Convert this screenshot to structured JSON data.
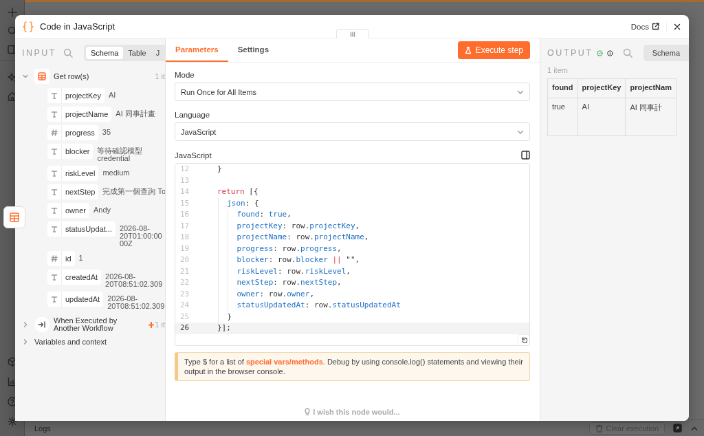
{
  "header": {
    "title": "Code in JavaScript",
    "docs": "Docs"
  },
  "input": {
    "label": "INPUT",
    "tabs": [
      {
        "label": "Schema",
        "selected": true
      },
      {
        "label": "Table",
        "selected": false
      },
      {
        "label": "J",
        "selected": false
      }
    ],
    "nodes": [
      {
        "name": "Get row(s)",
        "count": "1 it",
        "kind": "table",
        "expanded": true,
        "pinned": false,
        "fields": [
          {
            "kind": "string",
            "name": "projectKey",
            "value": "AI"
          },
          {
            "kind": "string",
            "name": "projectName",
            "value": "AI 同事計畫"
          },
          {
            "kind": "number",
            "name": "progress",
            "value": "35"
          },
          {
            "kind": "string",
            "name": "blocker",
            "value": "等待確認模型\ncredential"
          },
          {
            "kind": "string",
            "name": "riskLevel",
            "value": "medium"
          },
          {
            "kind": "string",
            "name": "nextStep",
            "value": "完成第一個查詢 To"
          },
          {
            "kind": "string",
            "name": "owner",
            "value": "Andy"
          },
          {
            "kind": "string",
            "name": "statusUpdat...",
            "value": "2026-08-\n20T01:00:00\n00Z"
          },
          {
            "kind": "number",
            "name": "id",
            "value": "1"
          },
          {
            "kind": "string",
            "name": "createdAt",
            "value": "2026-08-\n20T08:51:02.309"
          },
          {
            "kind": "string",
            "name": "updatedAt",
            "value": "2026-08-\n20T08:51:02.309"
          }
        ]
      },
      {
        "name": "When Executed by Another Workflow",
        "count": "1 it",
        "kind": "trigger",
        "expanded": false,
        "pinned": true
      }
    ],
    "variables": {
      "label": "Variables and context",
      "expanded": false
    }
  },
  "parameters": {
    "tabs": [
      {
        "label": "Parameters",
        "selected": true
      },
      {
        "label": "Settings",
        "selected": false
      }
    ],
    "execute_button": "Execute step",
    "fields": [
      {
        "label": "Mode",
        "value": "Run Once for All Items"
      },
      {
        "label": "Language",
        "value": "JavaScript"
      }
    ],
    "editor": {
      "label": "JavaScript",
      "lines": [
        {
          "number": "12",
          "active": false,
          "tokens": [
            {
              "kind": "plain",
              "text": "}"
            }
          ]
        },
        {
          "number": "13",
          "active": false
        },
        {
          "number": "14",
          "active": false,
          "tokens": [
            {
              "kind": "keyword",
              "text": "return"
            },
            {
              "kind": "plain",
              "text": " [{"
            }
          ],
          "children": [
            {
              "number": "15",
              "active": false,
              "tokens": [
                {
                  "kind": "property",
                  "text": "json"
                },
                {
                  "kind": "plain",
                  "text": ": {"
                }
              ],
              "children": [
                {
                  "number": "16",
                  "active": false,
                  "tokens": [
                    {
                      "kind": "property",
                      "text": "found"
                    },
                    {
                      "kind": "plain",
                      "text": ": "
                    },
                    {
                      "kind": "property",
                      "text": "true"
                    },
                    {
                      "kind": "plain",
                      "text": ","
                    }
                  ]
                },
                {
                  "number": "17",
                  "active": false,
                  "tokens": [
                    {
                      "kind": "property",
                      "text": "projectKey"
                    },
                    {
                      "kind": "plain",
                      "text": ": row."
                    },
                    {
                      "kind": "property",
                      "text": "projectKey"
                    },
                    {
                      "kind": "plain",
                      "text": ","
                    }
                  ]
                },
                {
                  "number": "18",
                  "active": false,
                  "tokens": [
                    {
                      "kind": "property",
                      "text": "projectName"
                    },
                    {
                      "kind": "plain",
                      "text": ": row."
                    },
                    {
                      "kind": "property",
                      "text": "projectName"
                    },
                    {
                      "kind": "plain",
                      "text": ","
                    }
                  ]
                },
                {
                  "number": "19",
                  "active": false,
                  "tokens": [
                    {
                      "kind": "property",
                      "text": "progress"
                    },
                    {
                      "kind": "plain",
                      "text": ": row."
                    },
                    {
                      "kind": "property",
                      "text": "progress"
                    },
                    {
                      "kind": "plain",
                      "text": ","
                    }
                  ]
                },
                {
                  "number": "20",
                  "active": false,
                  "tokens": [
                    {
                      "kind": "property",
                      "text": "blocker"
                    },
                    {
                      "kind": "plain",
                      "text": ": row."
                    },
                    {
                      "kind": "property",
                      "text": "blocker"
                    },
                    {
                      "kind": "keyword",
                      "text": " ||"
                    },
                    {
                      "kind": "plain",
                      "text": " \"\","
                    }
                  ]
                },
                {
                  "number": "21",
                  "active": false,
                  "tokens": [
                    {
                      "kind": "property",
                      "text": "riskLevel"
                    },
                    {
                      "kind": "plain",
                      "text": ": row."
                    },
                    {
                      "kind": "property",
                      "text": "riskLevel"
                    },
                    {
                      "kind": "plain",
                      "text": ","
                    }
                  ]
                },
                {
                  "number": "22",
                  "active": false,
                  "tokens": [
                    {
                      "kind": "property",
                      "text": "nextStep"
                    },
                    {
                      "kind": "plain",
                      "text": ": row."
                    },
                    {
                      "kind": "property",
                      "text": "nextStep"
                    },
                    {
                      "kind": "plain",
                      "text": ","
                    }
                  ]
                },
                {
                  "number": "23",
                  "active": false,
                  "tokens": [
                    {
                      "kind": "property",
                      "text": "owner"
                    },
                    {
                      "kind": "plain",
                      "text": ": row."
                    },
                    {
                      "kind": "property",
                      "text": "owner"
                    },
                    {
                      "kind": "plain",
                      "text": ","
                    }
                  ]
                },
                {
                  "number": "24",
                  "active": false,
                  "tokens": [
                    {
                      "kind": "property",
                      "text": "statusUpdatedAt"
                    },
                    {
                      "kind": "plain",
                      "text": ": row."
                    },
                    {
                      "kind": "property",
                      "text": "statusUpdatedAt"
                    }
                  ]
                }
              ]
            },
            {
              "number": "25",
              "active": false,
              "tokens": [
                {
                  "kind": "plain",
                  "text": "}"
                }
              ]
            }
          ]
        },
        {
          "number": "26",
          "active": true,
          "tokens": [
            {
              "kind": "plain",
              "text": "}];"
            }
          ]
        }
      ]
    },
    "hint": {
      "before": "Type $ for a list of ",
      "link": "special vars/methods",
      "after": ". Debug by using console.log() statements and viewing their output in the browser console."
    },
    "feedback": "I wish this node would..."
  },
  "output": {
    "label": "OUTPUT",
    "success": true,
    "tabs": [
      {
        "label": "Schema",
        "selected": false
      }
    ],
    "count": "1 item",
    "table": {
      "columns": [
        "found",
        "projectKey",
        "projectNam"
      ],
      "rows": [
        [
          "true",
          "AI",
          "AI 同事計"
        ]
      ]
    }
  },
  "logs": {
    "label": "Logs",
    "clear_button": "Clear execution",
    "clear_disabled": true
  }
}
